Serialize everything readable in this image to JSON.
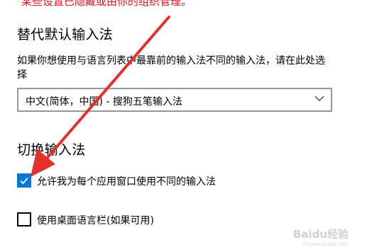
{
  "top_notice": "某些设置已隐藏或由你的组织管理。",
  "override_section": {
    "heading": "替代默认输入法",
    "description": "如果你想使用与语言列表中最靠前的输入法不同的输入法，请在此处选择",
    "dropdown_value": "中文(简体，中国) - 搜狗五笔输入法"
  },
  "switch_section": {
    "heading": "切换输入法",
    "option1": {
      "label": "允许我为每个应用窗口使用不同的输入法",
      "checked": true
    },
    "option2": {
      "label": "使用桌面语言栏(如果可用)",
      "checked": false
    }
  },
  "watermark": {
    "text": "Baidu经验",
    "sub": "jingyan.baidu.com"
  },
  "colors": {
    "accent": "#0078d7",
    "notice": "#e81123",
    "arrow": "#e3302c"
  }
}
